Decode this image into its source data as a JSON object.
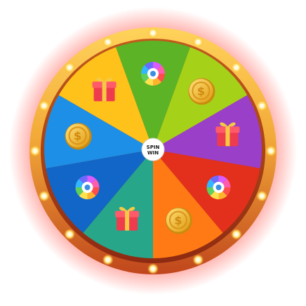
{
  "game": {
    "hub_line1": "SPIN",
    "hub_line2": "WIN",
    "segments": [
      {
        "color": "#5bb325",
        "icon": "color-wheel-icon"
      },
      {
        "color": "#a6d119",
        "icon": "dollar-coin-icon"
      },
      {
        "color": "#9a3fc7",
        "icon": "gift-box-icon"
      },
      {
        "color": "#e2301c",
        "icon": "color-wheel-icon"
      },
      {
        "color": "#ff7a14",
        "icon": "dollar-coin-icon"
      },
      {
        "color": "#27a68a",
        "icon": "gift-box-icon"
      },
      {
        "color": "#1166c7",
        "icon": "color-wheel-icon"
      },
      {
        "color": "#1e8fe6",
        "icon": "dollar-coin-icon"
      },
      {
        "color": "#ffc21a",
        "icon": "gift-box-icon"
      }
    ],
    "rim_lights": 16,
    "colors": {
      "rim_gold": "#f6b436",
      "rim_dark": "#b4451e",
      "glow": "#ff3b2f",
      "coin": "#f3b52a",
      "gift": "#ef3b4e",
      "ribbon": "#f6c945"
    }
  }
}
